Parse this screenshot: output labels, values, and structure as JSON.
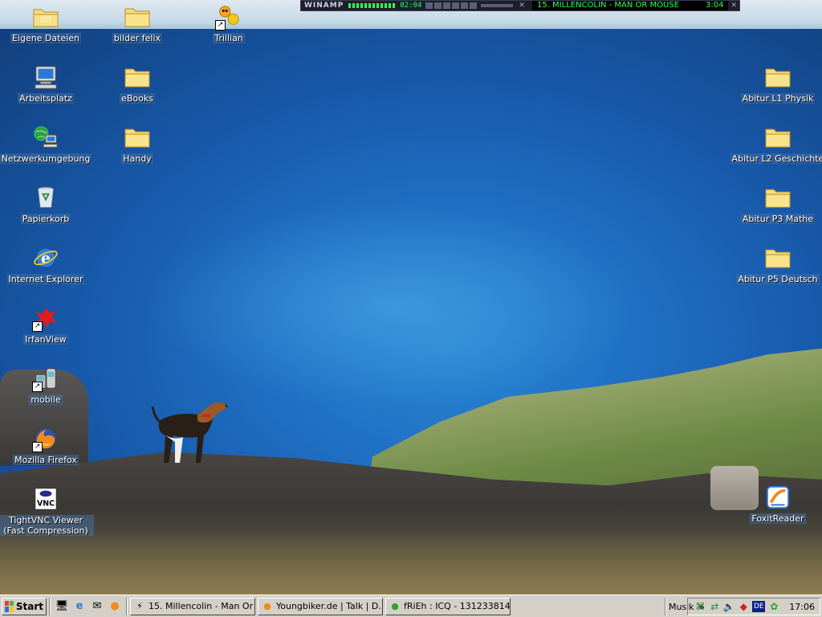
{
  "desktop": {
    "icons": [
      {
        "label": "Eigene Dateien"
      },
      {
        "label": "bilder felix"
      },
      {
        "label": "Trillian"
      },
      {
        "label": "Arbeitsplatz"
      },
      {
        "label": "eBooks"
      },
      {
        "label": "Netzwerkumgebung"
      },
      {
        "label": "Handy"
      },
      {
        "label": "Papierkorb"
      },
      {
        "label": "Internet Explorer"
      },
      {
        "label": "IrfanView"
      },
      {
        "label": "mobile"
      },
      {
        "label": "Mozilla Firefox"
      },
      {
        "label": "TightVNC Viewer (Fast Compression)"
      },
      {
        "label": "Abitur L1 Physik"
      },
      {
        "label": "Abitur L2 Geschichte"
      },
      {
        "label": "Abitur P3 Mathe"
      },
      {
        "label": "Abitur P5 Deutsch"
      },
      {
        "label": "FoxitReader"
      }
    ]
  },
  "winamp": {
    "title": "WINAMP",
    "elapsed": "02:04",
    "track": "15. MILLENCOLIN - MAN OR MOUSE",
    "length": "3:04"
  },
  "taskbar": {
    "start_label": "Start",
    "quick_launch": [
      "desktop-icon",
      "ie-icon",
      "outlook-icon",
      "firefox-icon"
    ],
    "tasks": [
      {
        "label": "15. Millencolin - Man Or ..."
      },
      {
        "label": "Youngbiker.de | Talk | D..."
      },
      {
        "label": "fRiEh : ICQ - 131233814"
      }
    ],
    "toolbar_label": "Musik",
    "toolbar_chevron": "»",
    "language": "DE",
    "clock": "17:06"
  },
  "colors": {
    "taskbar": "#d4d0c8",
    "winamp_text": "#2cff50",
    "icon_label_bg": "#466ea0"
  }
}
